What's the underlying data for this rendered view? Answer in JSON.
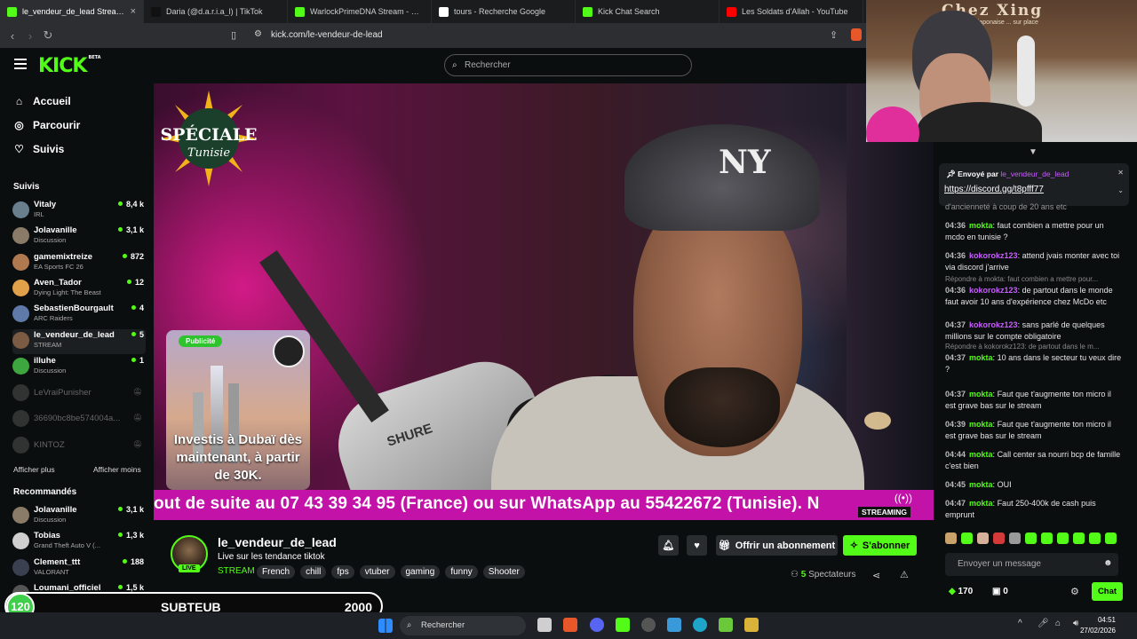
{
  "browser": {
    "tabs": [
      {
        "title": "le_vendeur_de_lead Stream -",
        "color": "#53fc18",
        "active": true
      },
      {
        "title": "Daria (@d.a.r.i.a_l) | TikTok",
        "color": "#111111"
      },
      {
        "title": "WarlockPrimeDNA Stream - Watch L",
        "color": "#53fc18"
      },
      {
        "title": "tours - Recherche Google",
        "color": "#ffffff"
      },
      {
        "title": "Kick Chat Search",
        "color": "#53fc18"
      },
      {
        "title": "Les Soldats d'Allah - YouTube",
        "color": "#ff0000"
      }
    ],
    "url": "kick.com/le-vendeur-de-lead"
  },
  "kick": {
    "logo": "KICK",
    "logo_badge": "BETA",
    "search_placeholder": "Rechercher"
  },
  "sidebar": {
    "nav": [
      {
        "label": "Accueil",
        "icon": "home-icon"
      },
      {
        "label": "Parcourir",
        "icon": "compass-icon"
      },
      {
        "label": "Suivis",
        "icon": "heart-icon"
      }
    ],
    "following_title": "Suivis",
    "following": [
      {
        "name": "Vitaly",
        "category": "IRL",
        "viewers": "8,4 k",
        "color": "#6a7f8e"
      },
      {
        "name": "Jolavanille",
        "category": "Discussion",
        "viewers": "3,1 k",
        "color": "#8a7a68"
      },
      {
        "name": "gamemixtreize",
        "category": "EA Sports FC 26",
        "viewers": "872",
        "color": "#b07a50"
      },
      {
        "name": "Aven_Tador",
        "category": "Dying Light: The Beast",
        "viewers": "12",
        "color": "#e0a14a"
      },
      {
        "name": "SebastienBourgault",
        "category": "ARC Raiders",
        "viewers": "4",
        "color": "#5f7aa8"
      },
      {
        "name": "le_vendeur_de_lead",
        "category": "STREAM",
        "viewers": "5",
        "color": "#7b5b44"
      },
      {
        "name": "illuhe",
        "category": "Discussion",
        "viewers": "1",
        "color": "#3ea63e"
      }
    ],
    "offline": [
      {
        "name": "LeVraiPunisher",
        "color": "#777777"
      },
      {
        "name": "36690bc8be574004a...",
        "color": "#777777"
      },
      {
        "name": "KINTOZ",
        "color": "#777777"
      }
    ],
    "show_more": "Afficher plus",
    "show_less": "Afficher moins",
    "recommended_title": "Recommandés",
    "recommended": [
      {
        "name": "Jolavanille",
        "category": "Discussion",
        "viewers": "3,1 k",
        "color": "#8a7a68"
      },
      {
        "name": "Tobias",
        "category": "Grand Theft Auto V (...",
        "viewers": "1,3 k",
        "color": "#cfcfcf"
      },
      {
        "name": "Clement_ttt",
        "category": "VALORANT",
        "viewers": "188",
        "color": "#3a4050"
      },
      {
        "name": "Loumani_officiel",
        "category": "Discussion",
        "viewers": "1,5 k",
        "color": "#555555"
      }
    ]
  },
  "video": {
    "badge": "SPÉCIALE Tunisie",
    "ticker": "out de suite au 07 43 39 34 95 (France) ou sur WhatsApp au 55422672 (Tunisie). N",
    "streaming_label": "STREAMING",
    "mic_brand": "SHURE",
    "cap_logo": "NY",
    "ad_tag": "Publicité",
    "ad_text": "Investis à Dubaï dès maintenant, à partir de 30K."
  },
  "stream": {
    "name": "le_vendeur_de_lead",
    "title": "Live sur les tendance tiktok",
    "category": "STREAM",
    "tags": [
      "French",
      "chill",
      "fps",
      "vtuber",
      "gaming",
      "funny",
      "Shooter"
    ],
    "live": "LIVE",
    "gift_label": "Offrir un abonnement",
    "sub_label": "S'abonner",
    "viewers_count": "5",
    "viewers_label": "Spectateurs"
  },
  "cam": {
    "sign": "Chez Xing",
    "sub": "...japonaise ... sur place"
  },
  "chat": {
    "pinned_by": "Envoyé par",
    "pinned_user": "le_vendeur_de_lead",
    "pinned_link": "https://discord.gg/t8pfff77",
    "cut_line": "d'ancienneté à coup de 20 ans etc",
    "messages": [
      {
        "time": "04:36",
        "user": "mokta",
        "color": "#53fc18",
        "text": "faut combien a mettre pour un mcdo en tunisie ?"
      },
      {
        "time": "04:36",
        "user": "kokorokz123",
        "color": "#c85cff",
        "text": "attend jvais monter avec toi via discord j'arrive"
      },
      {
        "time": "04:36",
        "user": "kokorokz123",
        "color": "#c85cff",
        "text": "de partout dans le monde faut avoir 10 ans d'expérience chez McDo etc",
        "reply": "Répondre à mokta: faut combien a mettre pour..."
      },
      {
        "time": "04:37",
        "user": "kokorokz123",
        "color": "#c85cff",
        "text": "sans parlé de quelques millions sur le compte obligatoire"
      },
      {
        "time": "04:37",
        "user": "mokta",
        "color": "#53fc18",
        "text": "10 ans dans le secteur tu veux dire ?",
        "reply": "Répondre à kokorokz123: de partout dans le m..."
      },
      {
        "time": "04:37",
        "user": "mokta",
        "color": "#53fc18",
        "text": "Faut que t'augmente ton micro il est grave bas sur le stream"
      },
      {
        "time": "04:39",
        "user": "mokta",
        "color": "#53fc18",
        "text": "Faut que t'augmente ton micro il est grave bas sur le stream"
      },
      {
        "time": "04:44",
        "user": "mokta",
        "color": "#53fc18",
        "text": "Call center sa nourri bcp de famille c'est bien"
      },
      {
        "time": "04:45",
        "user": "mokta",
        "color": "#53fc18",
        "text": "OUI"
      },
      {
        "time": "04:47",
        "user": "mokta",
        "color": "#53fc18",
        "text": "Faut 250-400k de cash puis emprunt"
      }
    ],
    "input_placeholder": "Envoyer un message",
    "points": "170",
    "gifts": "0",
    "send_label": "Chat"
  },
  "overlay": {
    "level": "120",
    "label": "SUBTEUB",
    "value": "2000"
  },
  "taskbar": {
    "search": "Rechercher",
    "time": "04:51",
    "date": "27/02/2026"
  }
}
